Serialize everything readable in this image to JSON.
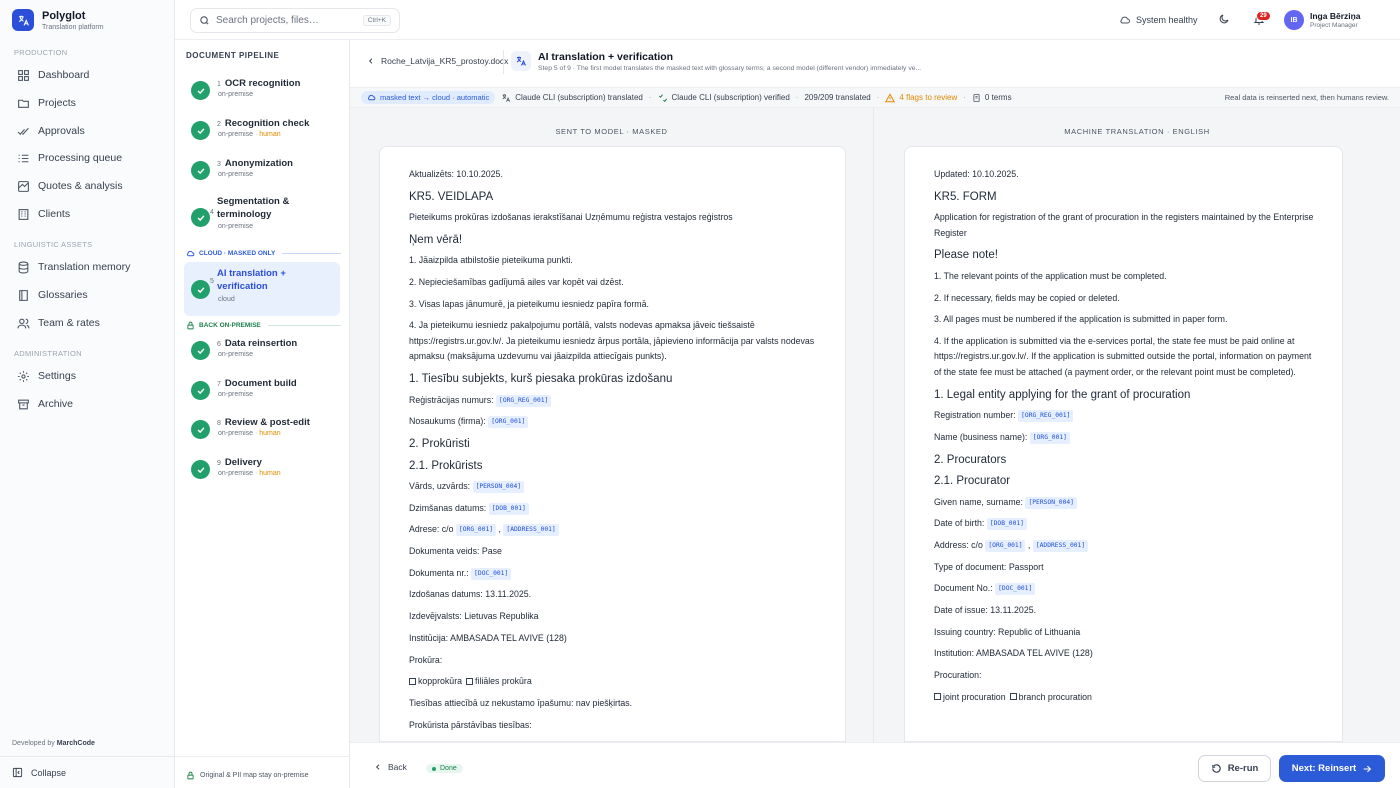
{
  "app": {
    "name": "Polyglot",
    "subtitle": "Translation platform"
  },
  "sidebar": {
    "sections": {
      "production": "PRODUCTION",
      "linguistic": "LINGUISTIC ASSETS",
      "admin": "ADMINISTRATION"
    },
    "items": [
      {
        "label": "Dashboard",
        "icon": "dashboard-icon"
      },
      {
        "label": "Projects",
        "icon": "folder-icon"
      },
      {
        "label": "Approvals",
        "icon": "check-double-icon"
      },
      {
        "label": "Processing queue",
        "icon": "queue-icon"
      },
      {
        "label": "Quotes & analysis",
        "icon": "quote-icon"
      },
      {
        "label": "Clients",
        "icon": "building-icon"
      },
      {
        "label": "Translation memory",
        "icon": "database-icon"
      },
      {
        "label": "Glossaries",
        "icon": "book-icon"
      },
      {
        "label": "Team & rates",
        "icon": "users-icon"
      },
      {
        "label": "Settings",
        "icon": "gear-icon"
      },
      {
        "label": "Archive",
        "icon": "archive-icon"
      }
    ],
    "developed_by": "Developed by",
    "developer": "MarchCode",
    "collapse": "Collapse"
  },
  "topbar": {
    "search_placeholder": "Search projects, files…",
    "search_shortcut": "Ctrl+K",
    "system_status": "System healthy",
    "notifications": "29",
    "user": {
      "initials": "IB",
      "name": "Inga Bērziņa",
      "role": "Project Manager"
    }
  },
  "pipeline": {
    "title": "DOCUMENT PIPELINE",
    "zone_cloud": "CLOUD · MASKED ONLY",
    "zone_back": "BACK ON-PREMISE",
    "steps": [
      {
        "num": "1",
        "title": "OCR recognition",
        "meta": "on-premise",
        "human": ""
      },
      {
        "num": "2",
        "title": "Recognition check",
        "meta": "on-premise",
        "human": "human"
      },
      {
        "num": "3",
        "title": "Anonymization",
        "meta": "on-premise",
        "human": ""
      },
      {
        "num": "4",
        "title": "Segmentation & terminology",
        "meta": "on-premise",
        "human": ""
      },
      {
        "num": "5",
        "title": "AI translation + verification",
        "meta": "cloud",
        "human": ""
      },
      {
        "num": "6",
        "title": "Data reinsertion",
        "meta": "on-premise",
        "human": ""
      },
      {
        "num": "7",
        "title": "Document build",
        "meta": "on-premise",
        "human": ""
      },
      {
        "num": "8",
        "title": "Review & post-edit",
        "meta": "on-premise",
        "human": "human"
      },
      {
        "num": "9",
        "title": "Delivery",
        "meta": "on-premise",
        "human": "human"
      }
    ],
    "separator": "·",
    "footer_note": "Original & PII map stay on-premise"
  },
  "main": {
    "file": "Roche_Latvija_KR5_prostoy.docx",
    "step_title": "AI translation + verification",
    "step_desc": "Step 5 of 9 · The first model translates the masked text with glossary terms; a second model (different vendor) immediately ve...",
    "status": {
      "mode": "masked text → cloud · automatic",
      "translated_by": "Claude CLI (subscription) translated",
      "verified_by": "Claude CLI (subscription) verified",
      "progress": "209/209 translated",
      "flags": "4 flags to review",
      "terms": "0 terms",
      "note": "Real data is reinserted next, then humans review.",
      "sep": "·"
    },
    "left_title": "SENT TO MODEL · MASKED",
    "right_title": "MACHINE TRANSLATION · ENGLISH",
    "left_doc": [
      {
        "t": "p",
        "text": "Aktualizēts: 10.10.2025."
      },
      {
        "t": "h",
        "text": "KR5. VEIDLAPA"
      },
      {
        "t": "p",
        "text": "Pieteikums prokūras izdošanas ierakstīšanai Uzņēmumu reģistra vestajos reģistros"
      },
      {
        "t": "h",
        "text": "Ņem vērā!"
      },
      {
        "t": "p",
        "text": "1. Jāaizpilda atbilstošie pieteikuma punkti."
      },
      {
        "t": "p",
        "text": "2. Nepieciešamības gadījumā ailes var kopēt vai dzēst."
      },
      {
        "t": "p",
        "text": "3. Visas lapas jānumurē, ja pieteikumu iesniedz papīra formā."
      },
      {
        "t": "p",
        "text": "4. Ja pieteikumu iesniedz pakalpojumu portālā, valsts nodevas apmaksa jāveic tiešsaistē https://registrs.ur.gov.lv/. Ja pieteikumu iesniedz ārpus portāla, jāpievieno informācija par valsts nodevas apmaksu (maksājuma uzdevumu vai jāaizpilda attiecīgais punkts)."
      },
      {
        "t": "h",
        "text": "1. Tiesību subjekts, kurš piesaka prokūras izdošanu"
      },
      {
        "t": "p",
        "text": "Reģistrācijas numurs:",
        "tokens": [
          "[ORG_REG_001]"
        ]
      },
      {
        "t": "p",
        "text": "Nosaukums (firma):",
        "tokens": [
          "[ORG_001]"
        ]
      },
      {
        "t": "h",
        "text": "2. Prokūristi"
      },
      {
        "t": "h",
        "text": "2.1. Prokūrists"
      },
      {
        "t": "p",
        "text": "Vārds, uzvārds:",
        "tokens": [
          "[PERSON_004]"
        ]
      },
      {
        "t": "p",
        "text": "Dzimšanas datums:",
        "tokens": [
          "[DOB_001]"
        ]
      },
      {
        "t": "p",
        "text": "Adrese: c/o",
        "tokens": [
          "[ORG_001]",
          "[ADDRESS_001]"
        ]
      },
      {
        "t": "p",
        "text": "Dokumenta veids: Pase"
      },
      {
        "t": "p",
        "text": "Dokumenta nr.:",
        "tokens": [
          "[DOC_001]"
        ]
      },
      {
        "t": "p",
        "text": "Izdošanas datums: 13.11.2025."
      },
      {
        "t": "p",
        "text": "Izdevējvalsts: Lietuvas Republika"
      },
      {
        "t": "p",
        "text": "Institūcija: AMBASADA TEL AVIVE (128)"
      },
      {
        "t": "p",
        "text": "Prokūra:"
      },
      {
        "t": "c",
        "a": "kopprokūra",
        "b": "filiāles prokūra"
      },
      {
        "t": "p",
        "text": "Tiesības attiecībā uz nekustamo īpašumu: nav piešķirtas."
      },
      {
        "t": "p",
        "text": "Prokūrista pārstāvības tiesības:"
      }
    ],
    "right_doc": [
      {
        "t": "p",
        "text": "Updated: 10.10.2025."
      },
      {
        "t": "h",
        "text": "KR5. FORM"
      },
      {
        "t": "p",
        "text": "Application for registration of the grant of procuration in the registers maintained by the Enterprise Register"
      },
      {
        "t": "h",
        "text": "Please note!"
      },
      {
        "t": "p",
        "text": "1. The relevant points of the application must be completed."
      },
      {
        "t": "p",
        "text": "2. If necessary, fields may be copied or deleted."
      },
      {
        "t": "p",
        "text": "3. All pages must be numbered if the application is submitted in paper form."
      },
      {
        "t": "p",
        "text": "4. If the application is submitted via the e-services portal, the state fee must be paid online at https://registrs.ur.gov.lv/. If the application is submitted outside the portal, information on payment of the state fee must be attached (a payment order, or the relevant point must be completed)."
      },
      {
        "t": "h",
        "text": "1. Legal entity applying for the grant of procuration"
      },
      {
        "t": "p",
        "text": "Registration number:",
        "tokens": [
          "[ORG_REG_001]"
        ]
      },
      {
        "t": "p",
        "text": "Name (business name):",
        "tokens": [
          "[ORG_001]"
        ]
      },
      {
        "t": "h",
        "text": "2. Procurators"
      },
      {
        "t": "h",
        "text": "2.1. Procurator"
      },
      {
        "t": "p",
        "text": "Given name, surname:",
        "tokens": [
          "[PERSON_004]"
        ]
      },
      {
        "t": "p",
        "text": "Date of birth:",
        "tokens": [
          "[DOB_001]"
        ]
      },
      {
        "t": "p",
        "text": "Address: c/o",
        "tokens": [
          "[ORG_001]",
          "[ADDRESS_001]"
        ]
      },
      {
        "t": "p",
        "text": "Type of document: Passport"
      },
      {
        "t": "p",
        "text": "Document No.:",
        "tokens": [
          "[DOC_001]"
        ]
      },
      {
        "t": "p",
        "text": "Date of issue: 13.11.2025."
      },
      {
        "t": "p",
        "text": "Issuing country: Republic of Lithuania"
      },
      {
        "t": "p",
        "text": "Institution: AMBASADA TEL AVIVE (128)"
      },
      {
        "t": "p",
        "text": "Procuration:"
      },
      {
        "t": "c",
        "a": "joint procuration",
        "b": "branch procuration"
      }
    ],
    "footer": {
      "back": "Back",
      "done": "Done",
      "rerun": "Re-run",
      "next": "Next: Reinsert"
    }
  },
  "colors": {
    "accent": "#2b5bd7",
    "success": "#22a06b",
    "warning": "#e08a00",
    "danger": "#dc2626"
  }
}
